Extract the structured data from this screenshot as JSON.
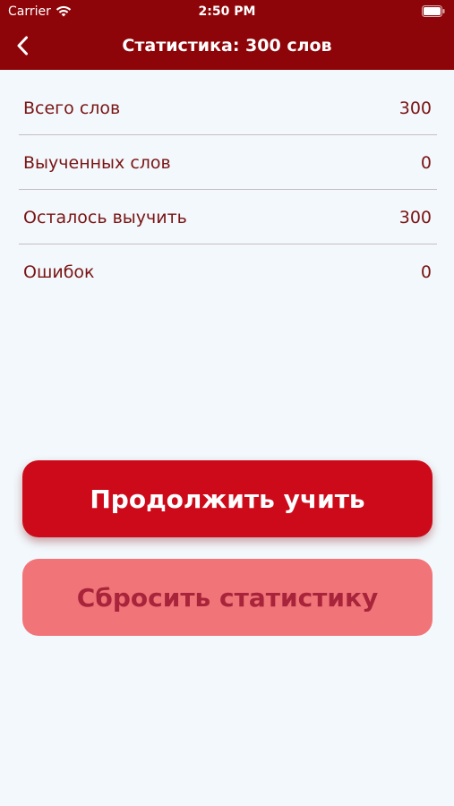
{
  "status_bar": {
    "carrier": "Carrier",
    "time": "2:50 PM",
    "wifi_icon": "wifi-icon",
    "battery_icon": "battery-icon"
  },
  "nav": {
    "back_icon": "chevron-left-icon",
    "title": "Статистика: 300 слов"
  },
  "stats": [
    {
      "label": "Всего слов",
      "value": "300"
    },
    {
      "label": "Выученных слов",
      "value": "0"
    },
    {
      "label": "Осталось выучить",
      "value": "300"
    },
    {
      "label": "Ошибок",
      "value": "0"
    }
  ],
  "buttons": {
    "continue_label": "Продолжить учить",
    "reset_label": "Сбросить статистику"
  },
  "colors": {
    "header": "#8e0509",
    "background": "#f2f8fc",
    "text": "#7a1414",
    "primary_button": "#cc0a1a",
    "secondary_button": "#f17479",
    "secondary_button_text": "#a8243a"
  }
}
